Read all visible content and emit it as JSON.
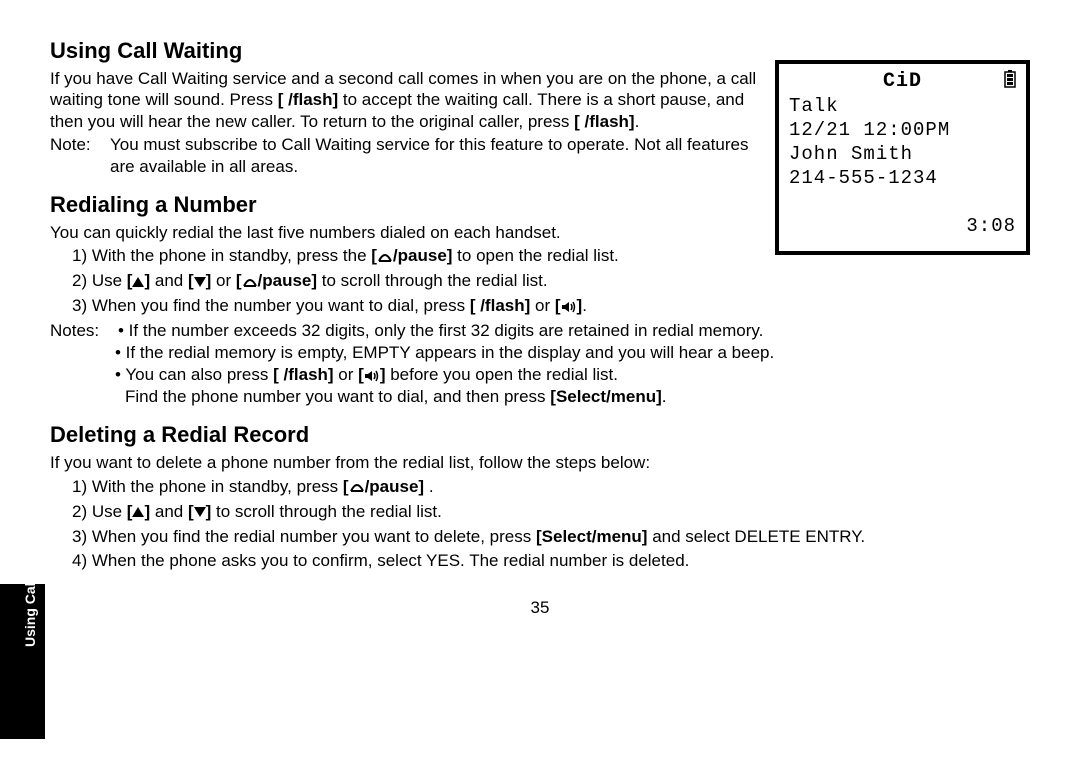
{
  "pageNumber": "35",
  "sideTab": "Using Caller ID, Call Waiting, and Redial Lists",
  "lcd": {
    "cid": "CiD",
    "talk": "Talk",
    "datetime": "12/21 12:00PM",
    "name": "John Smith",
    "number": "214-555-1234",
    "timer": "3:08"
  },
  "section1": {
    "heading": "Using Call Waiting",
    "body_a": "If you have Call Waiting service and a second call comes in when you are on the phone, a call waiting tone will sound. Press ",
    "flash1": "[ /flash]",
    "body_b": " to accept the waiting call. There is a short pause, and then you will hear the new caller. To return to the original caller, press ",
    "flash2": "[ /flash]",
    "body_c": ".",
    "noteLabel": "Note:",
    "noteText": "You must subscribe to Call Waiting service for this feature to operate. Not all features are available in all areas."
  },
  "section2": {
    "heading": "Redialing a Number",
    "intro": "You can quickly redial the last five numbers dialed on each handset.",
    "step1_a": "1) With the phone in standby, press the ",
    "pause1": "[    /pause]",
    "step1_b": " to open the redial list.",
    "step2_a": "2) Use ",
    "step2_b": " and ",
    "step2_c": " or ",
    "pause2": "[    /pause]",
    "step2_d": " to scroll through the redial list.",
    "step3_a": "3) When you find the number you want to dial, press ",
    "flash3": "[ /flash]",
    "step3_b": " or ",
    "speaker1": "[   ]",
    "step3_c": ".",
    "notesLabel": "Notes:",
    "nbullet1": "• If the number exceeds 32 digits, only the first 32 digits are retained in redial memory.",
    "nbullet2": "• If the redial memory is empty, EMPTY appears in the display and you will hear a beep.",
    "nbullet3_a": "• You can also press ",
    "flash4": "[ /flash]",
    "nbullet3_b": " or ",
    "speaker2": "[   ]",
    "nbullet3_c": " before you open the redial list.",
    "nfind_a": "Find the phone number you want to dial, and then press ",
    "selmenu1": "[Select/menu]",
    "nfind_b": "."
  },
  "section3": {
    "heading": "Deleting a Redial Record",
    "intro": "If you want to delete a phone number from the redial list, follow the steps below:",
    "step1_a": "1) With the phone in standby, press ",
    "pause3": "[    /pause]",
    "step1_b": " .",
    "step2_a": "2) Use ",
    "step2_b": " and ",
    "step2_c": " to scroll through the redial list.",
    "step3_a": "3) When you find the redial number you want to delete, press ",
    "selmenu2": "[Select/menu]",
    "step3_b": " and select DELETE ENTRY.",
    "step4": "4) When the phone asks you to confirm, select YES. The redial number is deleted."
  }
}
